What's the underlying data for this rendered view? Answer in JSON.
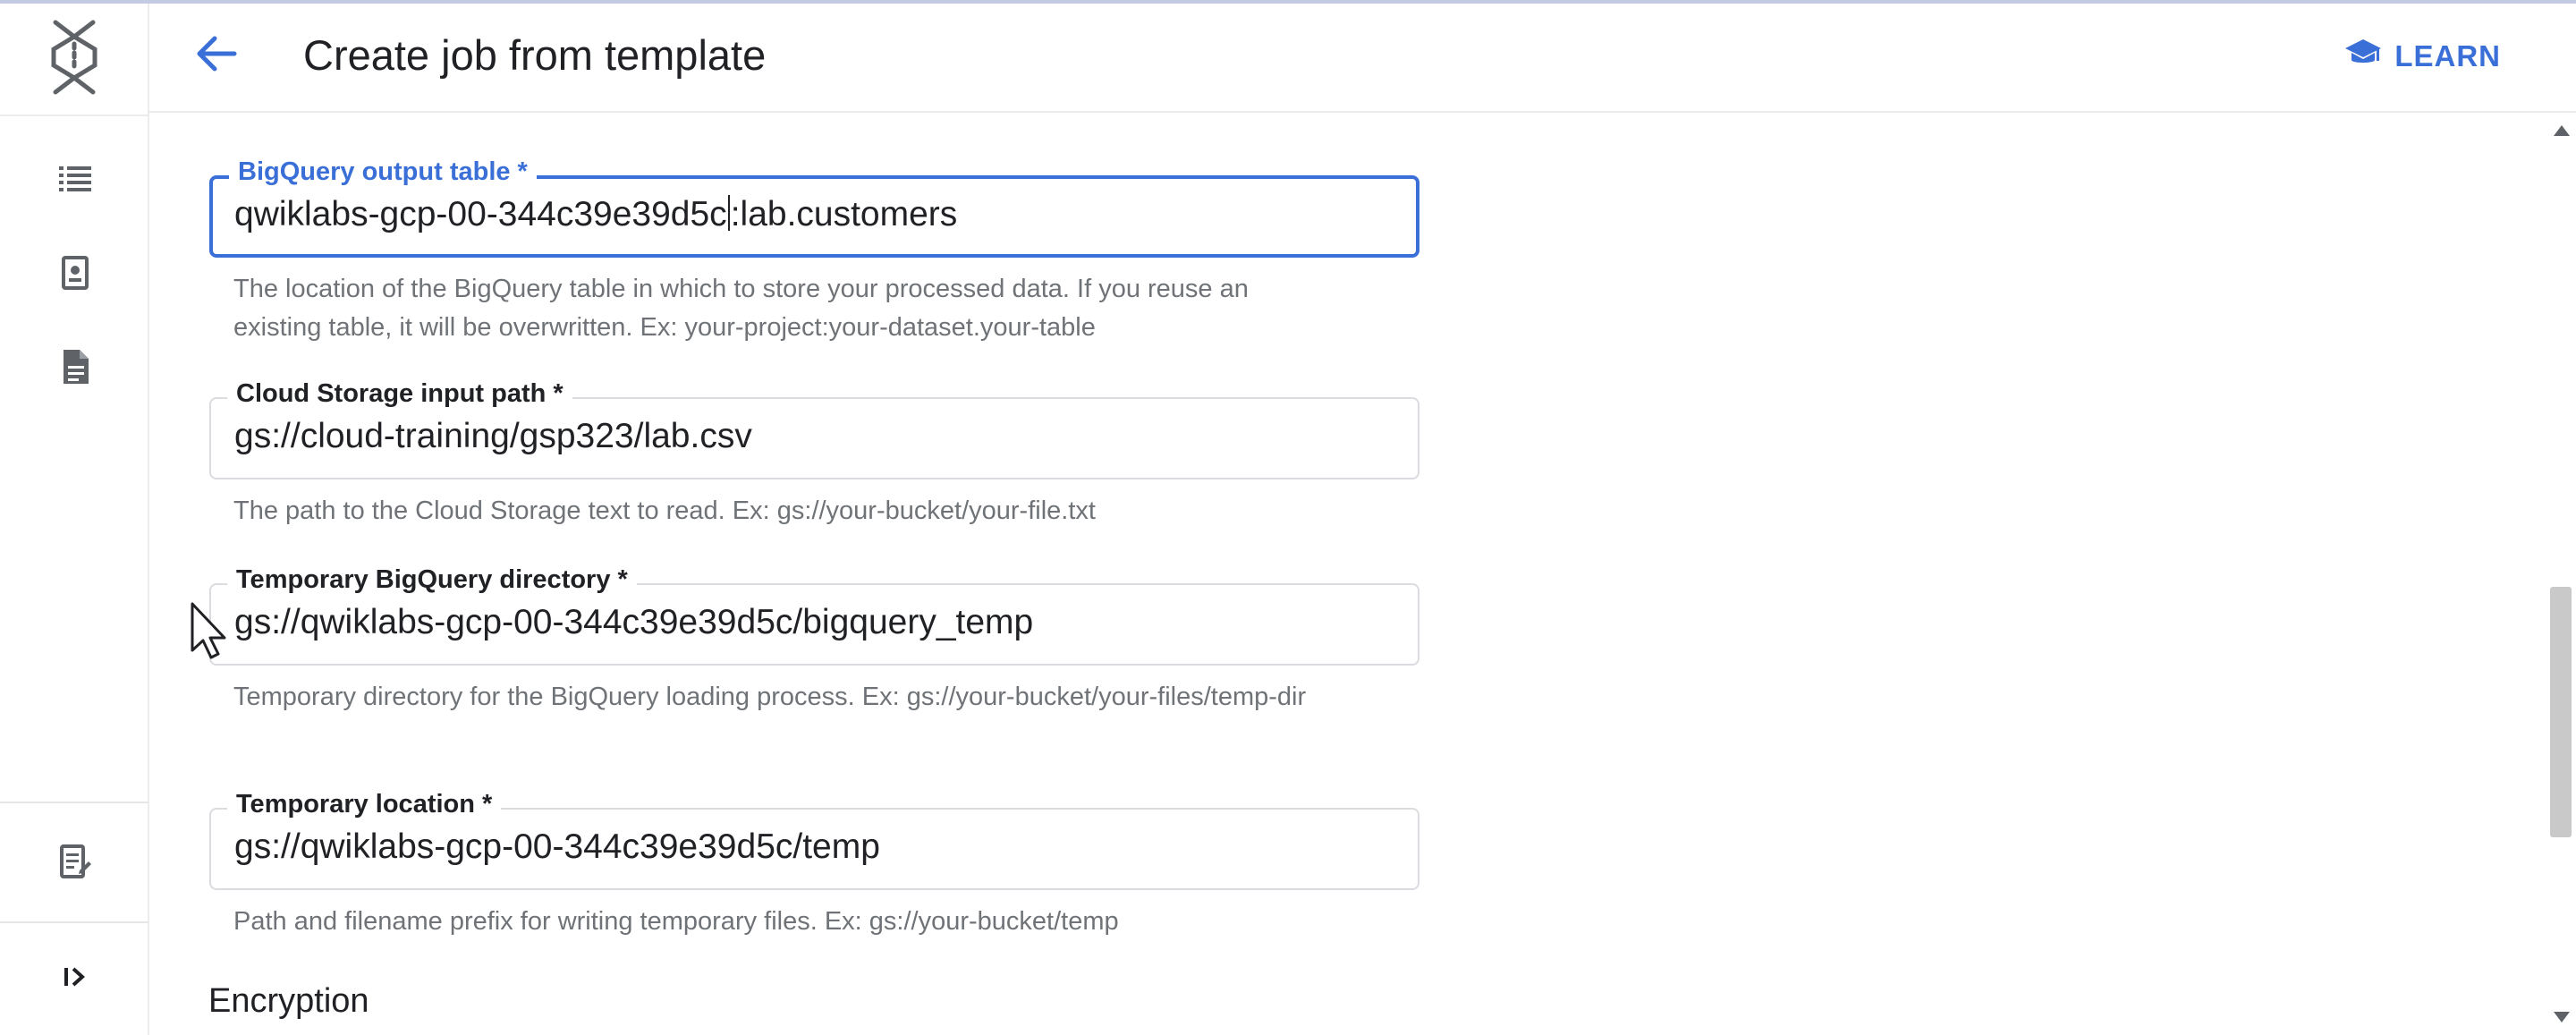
{
  "header": {
    "title": "Create job from template",
    "learn_label": "LEARN"
  },
  "icons": {
    "logo": "dataflow-logo-icon",
    "back": "arrow-left-icon",
    "learn": "school-cap-icon",
    "rail": [
      "list-icon",
      "snapshot-icon",
      "document-icon",
      "release-notes-icon",
      "expand-panel-icon"
    ]
  },
  "form": {
    "fields": [
      {
        "label": "BigQuery output table *",
        "value_before_caret": "qwiklabs-gcp-00-344c39e39d5c",
        "value_after_caret": ":lab.customers",
        "help": "The location of the BigQuery table in which to store your processed data. If you reuse an existing table, it will be overwritten. Ex: your-project:your-dataset.your-table",
        "focused": true
      },
      {
        "label": "Cloud Storage input path *",
        "value": "gs://cloud-training/gsp323/lab.csv",
        "help": "The path to the Cloud Storage text to read. Ex: gs://your-bucket/your-file.txt"
      },
      {
        "label": "Temporary BigQuery directory *",
        "value": "gs://qwiklabs-gcp-00-344c39e39d5c/bigquery_temp",
        "help": "Temporary directory for the BigQuery loading process. Ex: gs://your-bucket/your-files/temp-dir"
      },
      {
        "label": "Temporary location *",
        "value": "gs://qwiklabs-gcp-00-344c39e39d5c/temp",
        "help": "Path and filename prefix for writing temporary files. Ex: gs://your-bucket/temp"
      }
    ],
    "next_section": "Encryption"
  },
  "colors": {
    "accent": "#3a6fd8",
    "text": "#202124",
    "helper_text": "#6f7377",
    "border": "#dadce0"
  }
}
